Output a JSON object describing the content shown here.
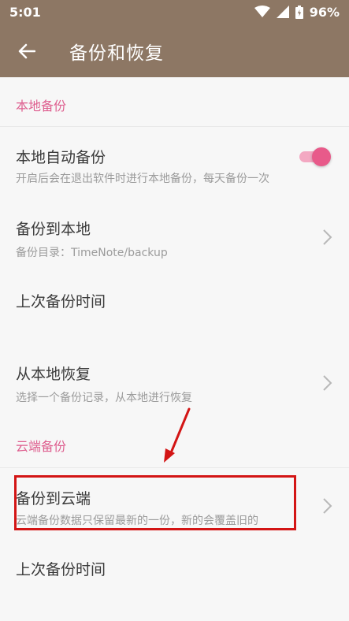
{
  "status_bar": {
    "time": "5:01",
    "battery": "96%"
  },
  "app_bar": {
    "title": "备份和恢复"
  },
  "colors": {
    "toolbar": "#8d7764",
    "accent": "#de5f8f",
    "highlight": "#d31515"
  },
  "local_section": {
    "header": "本地备份",
    "auto_backup": {
      "title": "本地自动备份",
      "subtitle": "开启后会在退出软件时进行本地备份，每天备份一次",
      "enabled": true
    },
    "backup_to_local": {
      "title": "备份到本地",
      "subtitle": "备份目录：TimeNote/backup"
    },
    "last_backup_time": {
      "title": "上次备份时间"
    },
    "restore_from_local": {
      "title": "从本地恢复",
      "subtitle": "选择一个备份记录，从本地进行恢复"
    }
  },
  "cloud_section": {
    "header": "云端备份",
    "backup_to_cloud": {
      "title": "备份到云端",
      "subtitle": "云端备份数据只保留最新的一份，新的会覆盖旧的"
    },
    "last_backup_time": {
      "title": "上次备份时间"
    }
  }
}
